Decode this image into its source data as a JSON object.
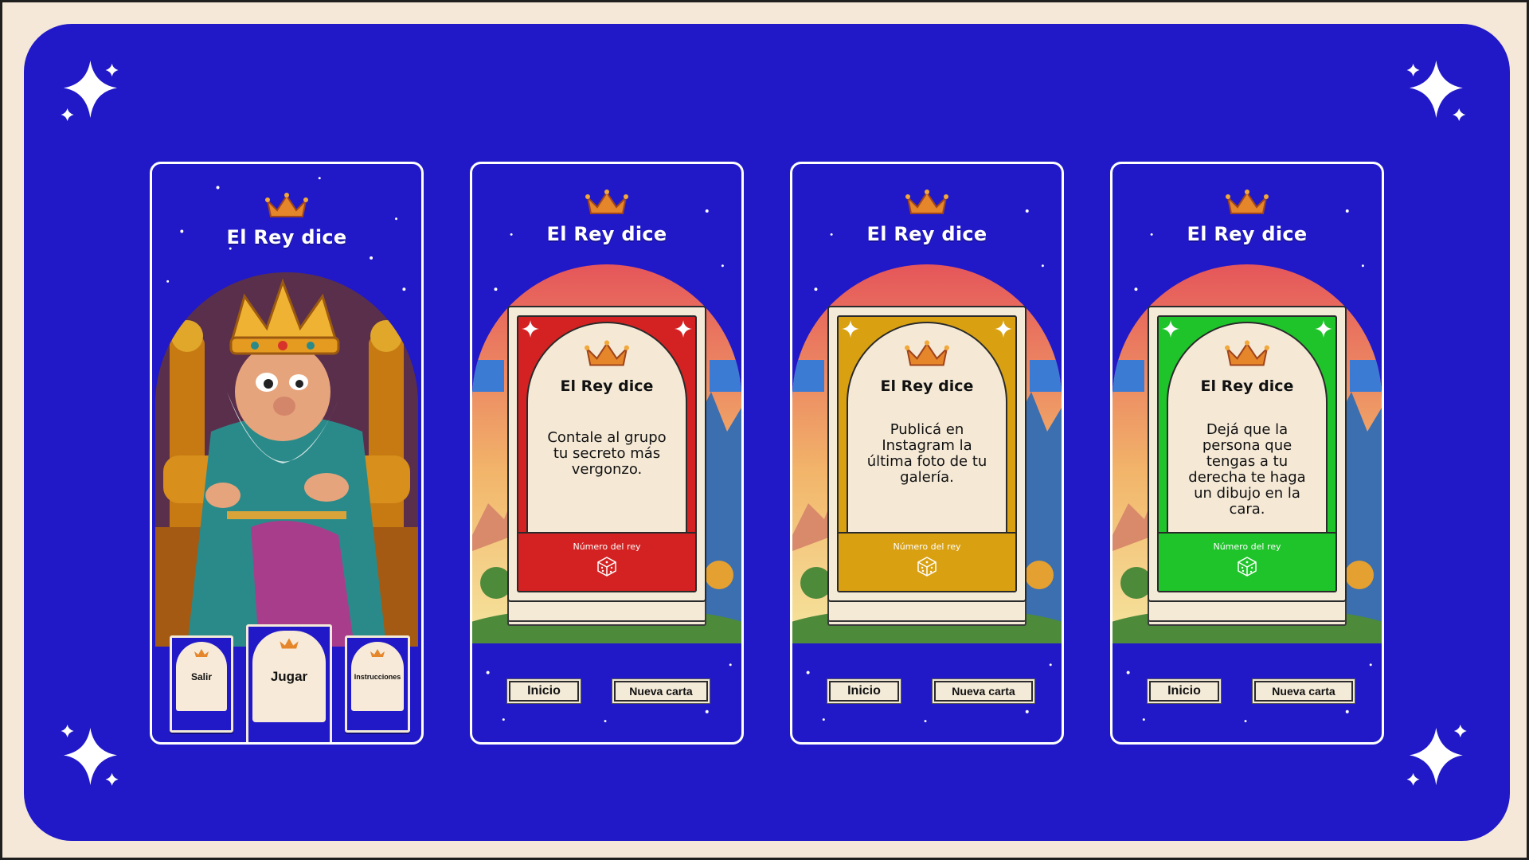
{
  "app": {
    "title": "El Rey dice"
  },
  "colors": {
    "background": "#f5e8d8",
    "board": "#2119c8",
    "card_cream": "#f3ead8",
    "red": "#d42222",
    "gold": "#d9a112",
    "green": "#1ec42a"
  },
  "home": {
    "menu": {
      "exit_label": "Salir",
      "play_label": "Jugar",
      "instructions_label": "Instrucciones"
    }
  },
  "cards": [
    {
      "color": "red",
      "title": "El Rey dice",
      "text": "Contale al grupo tu secreto más vergonzo.",
      "number_label": "Número del rey",
      "icon": "dice-icon"
    },
    {
      "color": "gold",
      "title": "El Rey dice",
      "text": "Publicá en Instagram la última foto de tu galería.",
      "number_label": "Número del rey",
      "icon": "dice-icon"
    },
    {
      "color": "green",
      "title": "El Rey dice",
      "text": "Dejá que la persona que tengas a tu derecha te haga un dibujo en la cara.",
      "number_label": "Número del rey",
      "icon": "dice-icon"
    }
  ],
  "buttons": {
    "home_label": "Inicio",
    "new_card_label": "Nueva carta"
  }
}
